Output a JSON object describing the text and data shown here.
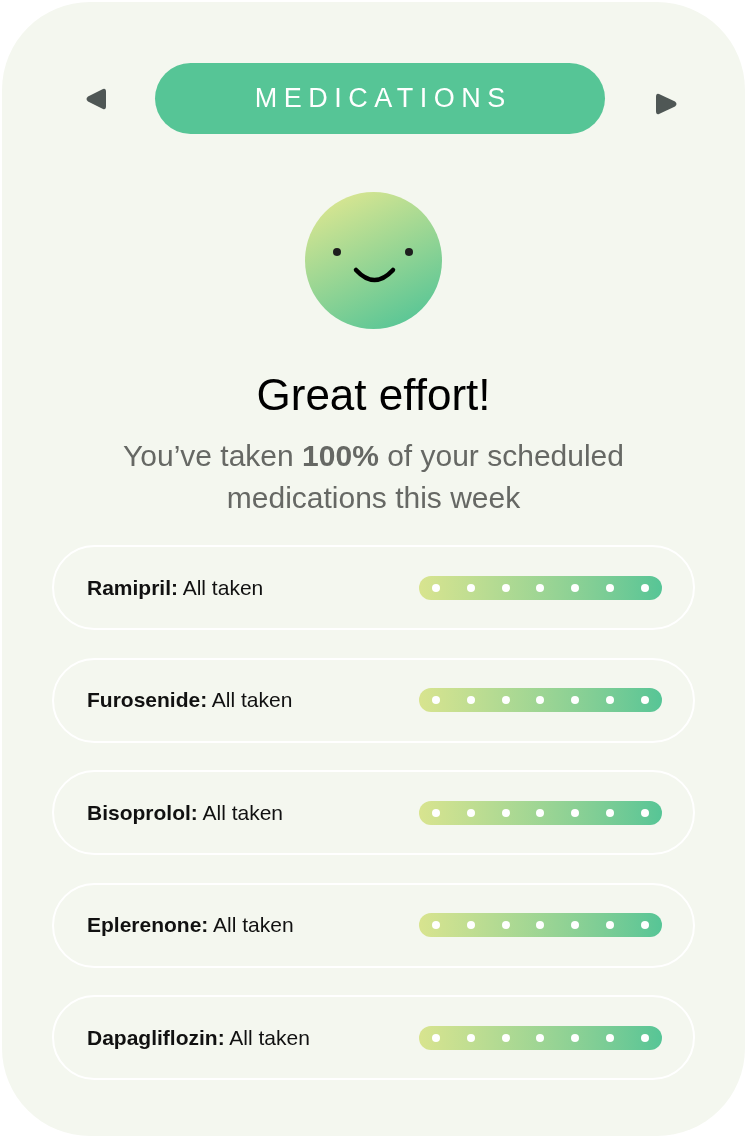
{
  "header": {
    "title": "MEDICATIONS"
  },
  "summary": {
    "heading": "Great effort!",
    "message": "You’ve taken **100%** of your scheduled medications this week"
  },
  "medications": [
    {
      "label": "**Ramipril:** All taken",
      "days": [
        {
          "taken": true
        },
        {
          "taken": true
        },
        {
          "taken": true
        },
        {
          "taken": true
        },
        {
          "taken": true
        },
        {
          "taken": true
        },
        {
          "taken": true
        }
      ]
    },
    {
      "label": "**Furosenide:** All taken",
      "days": [
        {
          "taken": true
        },
        {
          "taken": true
        },
        {
          "taken": true
        },
        {
          "taken": true
        },
        {
          "taken": true
        },
        {
          "taken": true
        },
        {
          "taken": true
        }
      ]
    },
    {
      "label": "**Bisoprolol:** All taken",
      "days": [
        {
          "taken": true
        },
        {
          "taken": true
        },
        {
          "taken": true
        },
        {
          "taken": true
        },
        {
          "taken": true
        },
        {
          "taken": true
        },
        {
          "taken": true
        }
      ]
    },
    {
      "label": "**Eplerenone:** All taken",
      "days": [
        {
          "taken": true
        },
        {
          "taken": true
        },
        {
          "taken": true
        },
        {
          "taken": true
        },
        {
          "taken": true
        },
        {
          "taken": true
        },
        {
          "taken": true
        }
      ]
    },
    {
      "label": "**Dapagliflozin:** All taken",
      "days": [
        {
          "taken": true
        },
        {
          "taken": true
        },
        {
          "taken": true
        },
        {
          "taken": true
        },
        {
          "taken": true
        },
        {
          "taken": true
        },
        {
          "taken": true
        }
      ]
    }
  ]
}
